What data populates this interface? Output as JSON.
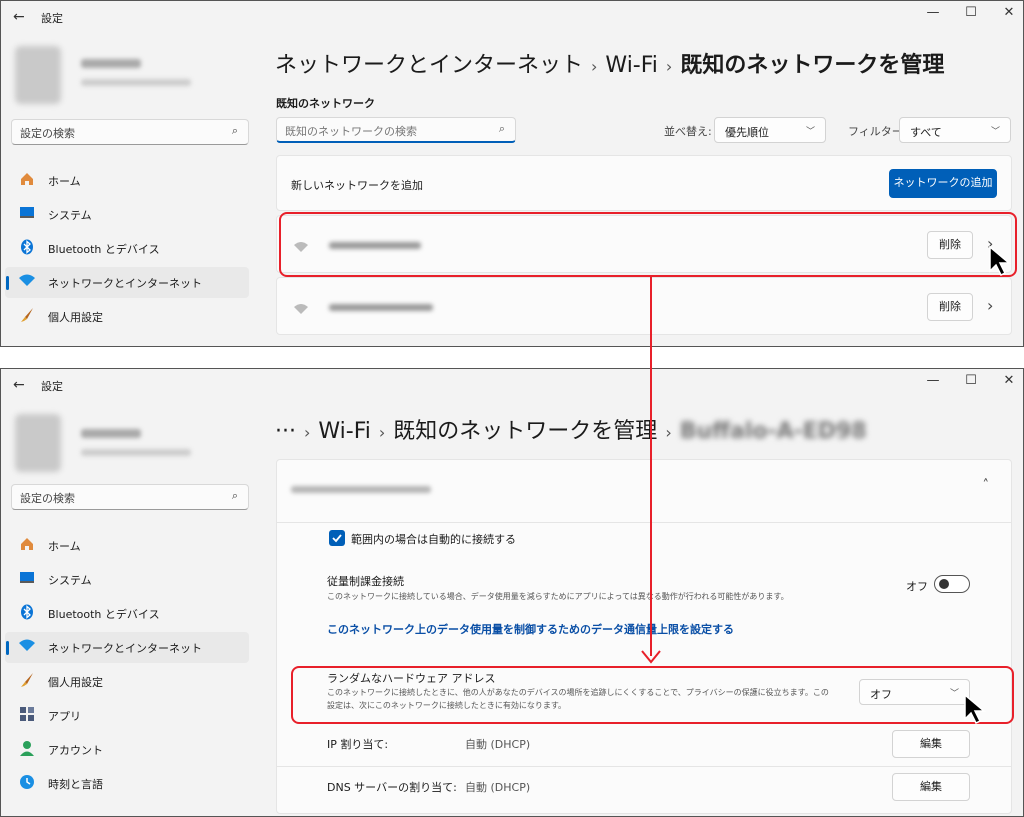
{
  "app": {
    "title": "設定",
    "back": "←"
  },
  "window_controls": {
    "minimize": "—",
    "maximize": "☐",
    "close": "✕"
  },
  "sidebar": {
    "search_placeholder": "設定の検索",
    "search_icon": "⌕",
    "items_top": [
      {
        "label": "ホーム",
        "icon": "home-icon"
      },
      {
        "label": "システム",
        "icon": "system-icon"
      },
      {
        "label": "Bluetooth とデバイス",
        "icon": "bluetooth-icon"
      },
      {
        "label": "ネットワークとインターネット",
        "icon": "wifi-icon"
      },
      {
        "label": "個人用設定",
        "icon": "brush-icon"
      }
    ],
    "items_bottom": [
      {
        "label": "ホーム",
        "icon": "home-icon"
      },
      {
        "label": "システム",
        "icon": "system-icon"
      },
      {
        "label": "Bluetooth とデバイス",
        "icon": "bluetooth-icon"
      },
      {
        "label": "ネットワークとインターネット",
        "icon": "wifi-icon"
      },
      {
        "label": "個人用設定",
        "icon": "brush-icon"
      },
      {
        "label": "アプリ",
        "icon": "apps-icon"
      },
      {
        "label": "アカウント",
        "icon": "account-icon"
      },
      {
        "label": "時刻と言語",
        "icon": "clock-icon"
      }
    ]
  },
  "top": {
    "breadcrumb": {
      "part1": "ネットワークとインターネット",
      "sep": "›",
      "part2": "Wi-Fi",
      "part3": "既知のネットワークを管理"
    },
    "section_title": "既知のネットワーク",
    "search_placeholder": "既知のネットワークの検索",
    "sort_label": "並べ替え:",
    "sort_value": "優先順位",
    "filter_label": "フィルター:",
    "filter_value": "すべて",
    "add_network_label": "新しいネットワークを追加",
    "add_network_button": "ネットワークの追加",
    "networks": [
      {
        "delete": "削除",
        "chevron": "›"
      },
      {
        "delete": "削除",
        "chevron": "›"
      }
    ]
  },
  "bottom": {
    "breadcrumb": {
      "ellipsis": "···",
      "sep": "›",
      "part2": "Wi-Fi",
      "part3": "既知のネットワークを管理"
    },
    "collapse_chevron": "˄",
    "auto_connect": "範囲内の場合は自動的に接続する",
    "metered_title": "従量制課金接続",
    "metered_desc": "このネットワークに接続している場合、データ使用量を減らすためにアプリによっては異なる動作が行われる可能性があります。",
    "metered_state": "オフ",
    "data_limit_link": "このネットワーク上のデータ使用量を制御するためのデータ通信量上限を設定する",
    "random_mac_title": "ランダムなハードウェア アドレス",
    "random_mac_desc1": "このネットワークに接続したときに、他の人があなたのデバイスの場所を追跡しにくくすることで、プライバシーの保護に役立ちます。この",
    "random_mac_desc2": "設定は、次にこのネットワークに接続したときに有効になります。",
    "random_mac_value": "オフ",
    "ip_label": "IP 割り当て:",
    "ip_value": "自動 (DHCP)",
    "dns_label": "DNS サーバーの割り当て:",
    "dns_value": "自動 (DHCP)",
    "edit_button": "編集"
  },
  "colors": {
    "accent": "#005fb8",
    "highlight": "#e8202a"
  }
}
